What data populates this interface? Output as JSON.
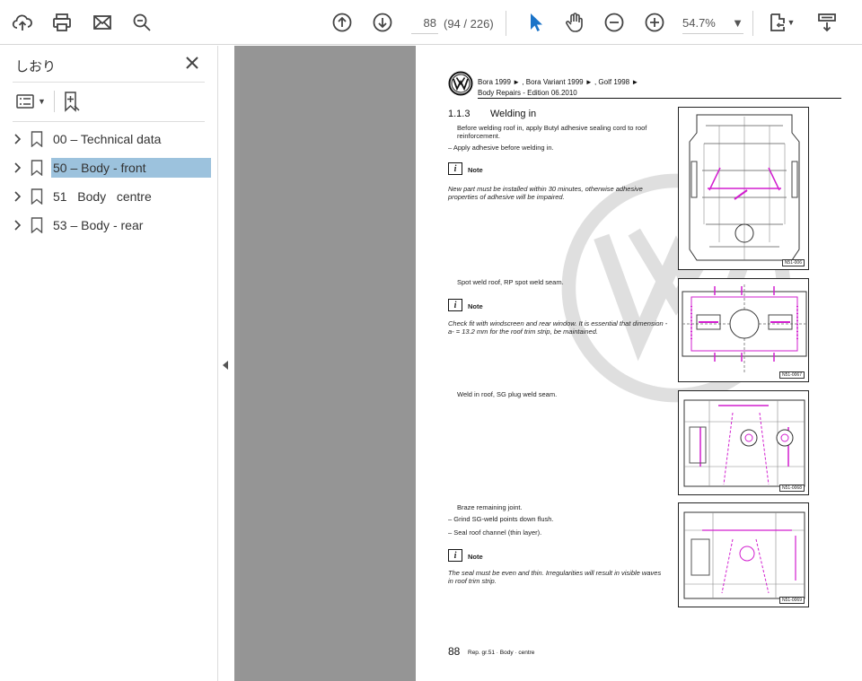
{
  "toolbar": {
    "page_current": "88",
    "page_total": "(94 / 226)",
    "zoom": "54.7%"
  },
  "sidebar": {
    "title": "しおり",
    "bookmarks": [
      {
        "label": "00 – Technical data",
        "selected": false
      },
      {
        "label": "50 – Body - front",
        "selected": true
      },
      {
        "label": "51   Body   centre",
        "selected": false
      },
      {
        "label": "53 – Body - rear",
        "selected": false
      }
    ]
  },
  "document": {
    "header_line1": "Bora 1999 ► , Bora Variant 1999 ► , Golf 1998 ►",
    "header_line2": "Body Repairs - Edition 06.2010",
    "section_number": "1.1.3",
    "section_title": "Welding in",
    "blocks": [
      "Before welding roof in, apply Butyl adhesive sealing cord to roof reinforcement.",
      "–  Apply adhesive before welding in.",
      "Note",
      "New part must be installed within 30 minutes, otherwise adhesive properties of adhesive will be impaired.",
      "Spot weld roof, RP spot weld seam.",
      "Note",
      "Check fit with windscreen and rear window. It is essential that dimension -a- = 13.2 mm for the roof trim strip, be maintained.",
      "Weld in roof, SG plug weld seam.",
      "Braze remaining joint.",
      "–  Grind SG-weld points down flush.",
      "–  Seal roof channel (thin layer).",
      "Note",
      "The seal must be even and thin. Irregularities will result in visible waves in roof trim strip."
    ],
    "figure_ids": [
      "N51-006",
      "N51-0067",
      "N51-0068",
      "N51-0069"
    ],
    "footer_page": "88",
    "footer_text": "Rep. gr.51 · Body · centre"
  },
  "colors": {
    "selected_bookmark": "#9cc2dd",
    "viewer_bg": "#959595",
    "accent_cursor": "#1a73c8",
    "figure_magenta": "#d21ecf"
  }
}
